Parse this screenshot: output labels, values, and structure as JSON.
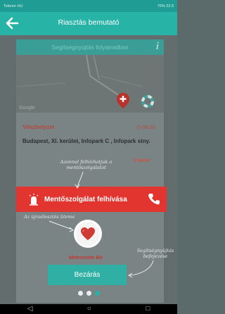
{
  "status_bar": {
    "left": "Telenor HU",
    "right": "75% 22:3"
  },
  "header": {
    "title": "Riasztás bemutató",
    "back_icon": "arrow-left-icon"
  },
  "subheader": {
    "text": "Segítségnyújtás folyamatban",
    "info_icon": "info-icon"
  },
  "map": {
    "attribution": "Google"
  },
  "alert": {
    "type": "Vészhelyzet",
    "time": "08:20",
    "address": "Budapest, XI. kerület, Infopark C , Infopark stny.",
    "distance": "0 méter"
  },
  "notes": {
    "call_hint": "Azonnal felhívhatjuk a mentőszolgálatot",
    "heart_hint": "Az újraélesztés üteme",
    "close_hint": "Segítségnyújtás befejezése"
  },
  "call_button": {
    "label": "Mentőszolgálat felhívása"
  },
  "metronome": {
    "label": "Metronóm Be"
  },
  "close_button": {
    "label": "Bezárás"
  },
  "pager": {
    "count": 3,
    "active": 2
  },
  "colors": {
    "teal": "#28b3a7",
    "red": "#e3352f"
  }
}
